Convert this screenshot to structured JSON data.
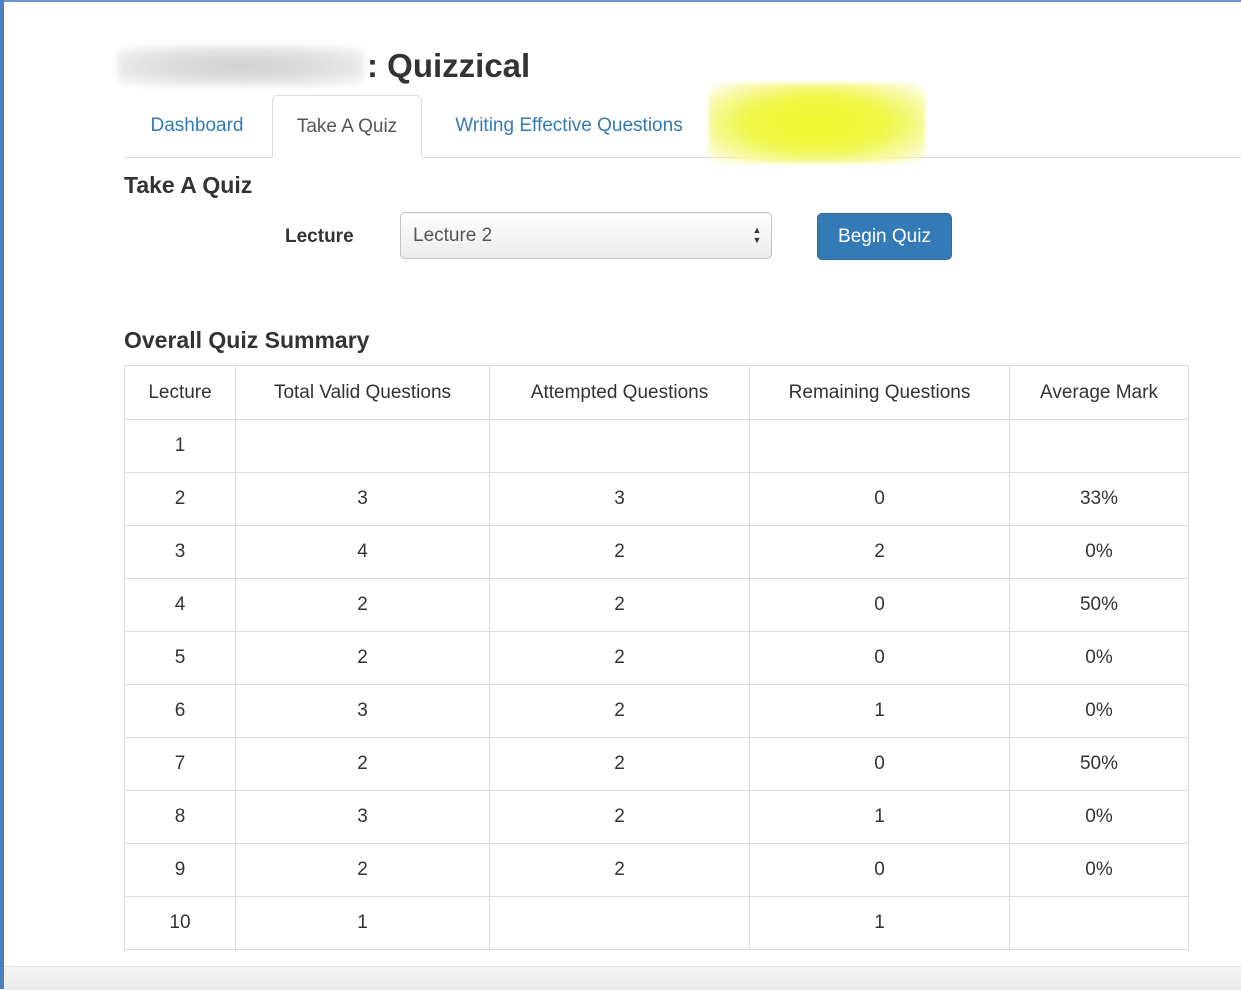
{
  "header": {
    "title_suffix": ": Quizzical"
  },
  "tabs": [
    {
      "label": "Dashboard",
      "active": false
    },
    {
      "label": "Take A Quiz",
      "active": true
    },
    {
      "label": "Writing Effective Questions",
      "active": false
    }
  ],
  "take_quiz": {
    "heading": "Take A Quiz",
    "lecture_label": "Lecture",
    "selected_lecture": "Lecture 2",
    "begin_button": "Begin Quiz"
  },
  "summary": {
    "heading": "Overall Quiz Summary",
    "columns": [
      "Lecture",
      "Total Valid Questions",
      "Attempted Questions",
      "Remaining Questions",
      "Average Mark"
    ],
    "rows": [
      [
        "1",
        "",
        "",
        "",
        ""
      ],
      [
        "2",
        "3",
        "3",
        "0",
        "33%"
      ],
      [
        "3",
        "4",
        "2",
        "2",
        "0%"
      ],
      [
        "4",
        "2",
        "2",
        "0",
        "50%"
      ],
      [
        "5",
        "2",
        "2",
        "0",
        "0%"
      ],
      [
        "6",
        "3",
        "2",
        "1",
        "0%"
      ],
      [
        "7",
        "2",
        "2",
        "0",
        "50%"
      ],
      [
        "8",
        "3",
        "2",
        "1",
        "0%"
      ],
      [
        "9",
        "2",
        "2",
        "0",
        "0%"
      ],
      [
        "10",
        "1",
        "",
        "1",
        ""
      ]
    ]
  },
  "colors": {
    "link": "#337ab7",
    "primary_button": "#337ab7",
    "border": "#dddddd",
    "highlight": "#eef62a"
  },
  "icons": {
    "select_arrows": "updown-arrows-icon"
  }
}
